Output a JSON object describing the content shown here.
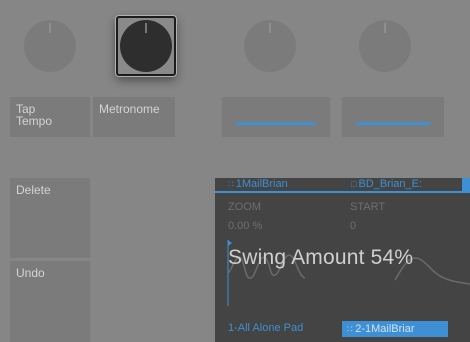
{
  "knobs": [
    "knob-1",
    "knob-2",
    "knob-3",
    "knob-4"
  ],
  "buttons": {
    "tap_tempo": [
      "Tap",
      "Tempo"
    ],
    "metronome": "Metronome",
    "delete": "Delete",
    "undo": "Undo"
  },
  "display": {
    "tabs": [
      {
        "icon": "grid-icon",
        "label": "1MailBrian"
      },
      {
        "icon": "square-icon",
        "label": "BD_Brian_E:"
      }
    ],
    "params": [
      {
        "name": "ZOOM",
        "value": "0.00 %"
      },
      {
        "name": "START",
        "value": "0"
      }
    ],
    "swing_label": "Swing Amount 54%",
    "clips": [
      {
        "label": "1-All Alone Pad",
        "selected": false
      },
      {
        "label": "2-1MailBriar",
        "selected": true
      }
    ]
  },
  "colors": {
    "accent": "#3e8fd4",
    "background": "#868686",
    "control": "#7b7b7b",
    "display": "#444444"
  }
}
